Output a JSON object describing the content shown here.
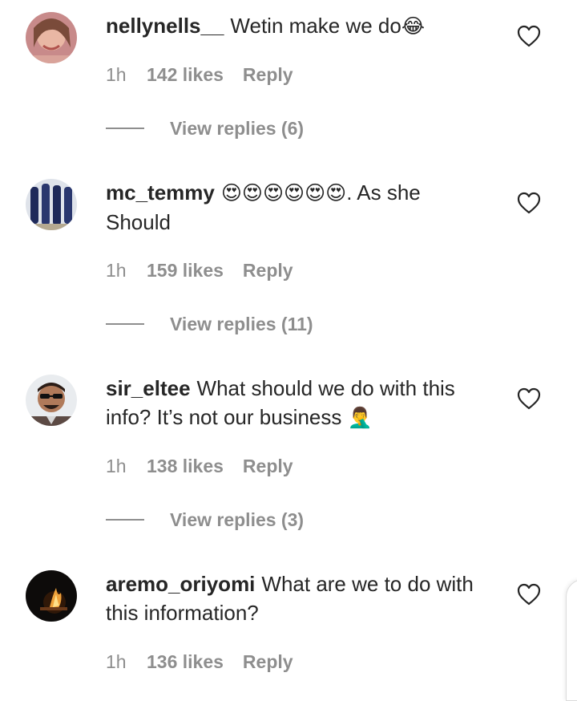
{
  "comments": [
    {
      "username": "nellynells__",
      "text": "Wetin make we do",
      "emoji_suffix": "😂",
      "time": "1h",
      "likes": "142 likes",
      "reply_label": "Reply",
      "view_replies": "View replies (6)"
    },
    {
      "username": "mc_temmy",
      "emoji_prefix": "😍😍😍😍😍😍",
      "text": ". As she Should",
      "time": "1h",
      "likes": "159 likes",
      "reply_label": "Reply",
      "view_replies": "View replies (11)"
    },
    {
      "username": "sir_eltee",
      "text": "What should we do with this info? It’s not our business",
      "emoji_suffix": "🤦‍♂️",
      "time": "1h",
      "likes": "138 likes",
      "reply_label": "Reply",
      "view_replies": "View replies (3)"
    },
    {
      "username": "aremo_oriyomi",
      "text": "What are we to do with this information?",
      "time": "1h",
      "likes": "136 likes",
      "reply_label": "Reply"
    }
  ],
  "icons": {
    "like": "heart-outline-icon"
  },
  "colors": {
    "text": "#262626",
    "secondary": "#8e8e8e",
    "background": "#ffffff"
  }
}
